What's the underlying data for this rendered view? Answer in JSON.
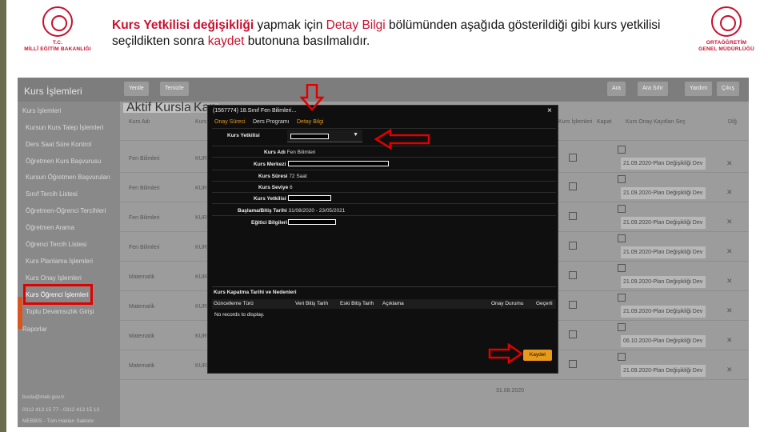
{
  "logo_left": {
    "line1": "T.C.",
    "line2": "MİLLÎ EĞİTİM BAKANLIĞI"
  },
  "logo_right": {
    "line1": "ORTAÖĞRETİM",
    "line2": "GENEL MÜDÜRLÜĞÜ"
  },
  "instruction": {
    "part1": "Kurs Yetkilisi değişikliği",
    "part2": " yapmak için ",
    "part3": "Detay Bilgi",
    "part4": " bölümünden aşağıda gösterildiği gibi kurs yetkilisi seçildikten sonra ",
    "part5": "kaydet",
    "part6": " butonuna basılmalıdır."
  },
  "app": {
    "title": "Kurs İşlemleri",
    "toolbar": [
      "Yenile",
      "Temizle"
    ],
    "toolbar_right": [
      "Ara",
      "Ara Sıfır",
      "Yardım",
      "Çıkış"
    ]
  },
  "sidebar": {
    "items": [
      "Kurs İşlemleri",
      "Kursun Kurs Talep İşlemleri",
      "Ders Saat Süre Kontrol",
      "Öğretmen Kurs Başvurusu",
      "Kursun Öğretmen Başvuruları",
      "Sınıf Tercih Listesi",
      "Öğretmen-Öğrenci Tercihleri",
      "Öğretmen Arama",
      "Öğrenci Tercih Listesi",
      "Kurs Planlama İşlemleri",
      "Kurs Onay İşlemleri",
      "Kurs Öğrenci İşlemleri",
      "Toplu Devamsızlık Girişi",
      "Raporlar"
    ],
    "footer": [
      "bsola@meb.gov.tr",
      "0312 413 15 77 - 0312 413 15 13",
      "MEBBİS - Tüm Hakları Saklıdır."
    ]
  },
  "tabs": [
    "Aktif Kurslar",
    "Kap"
  ],
  "columns": [
    "Kurs Adı",
    "Kurs",
    "Kurs İşlemleri",
    "Kapat",
    "Kurs Onay Kayıtları Seç",
    "Dİğ"
  ],
  "rows": [
    {
      "course": "Fen Bilimleri",
      "code": "KUR",
      "plan": "21.09.2020-Plan Değişikliği Dev"
    },
    {
      "course": "Fen Bilimleri",
      "code": "KUR",
      "plan": "21.09.2020-Plan Değişikliği Dev"
    },
    {
      "course": "Fen Bilimleri",
      "code": "KUR",
      "plan": "21.09.2020-Plan Değişikliği Dev"
    },
    {
      "course": "Fen Bilimleri",
      "code": "KUR",
      "plan": "21.09.2020-Plan Değişikliği Dev"
    },
    {
      "course": "Matematik",
      "code": "KUR",
      "plan": "21.09.2020-Plan Değişikliği Dev"
    },
    {
      "course": "Matematik",
      "code": "KUR",
      "plan": "21.09.2020-Plan Değişikliği Dev"
    },
    {
      "course": "Matematik",
      "code": "KUR",
      "plan": "06.10.2020-Plan Değişikliği Dev"
    },
    {
      "course": "Matematik",
      "code": "KUR",
      "plan": "21.09.2020-Plan Değişikliği Dev"
    }
  ],
  "last_row_date": "31.08.2020",
  "modal": {
    "title": "(1567774) 18.Sınıf Fen Bilimleri...",
    "close": "×",
    "tabs": [
      "Onay Süreci",
      "Ders Programı",
      "Detay Bilgi"
    ],
    "select_label": "Kurs Yetkilisi",
    "fields": [
      {
        "label": "Kurs Adı",
        "value": "Fen Bilimleri"
      },
      {
        "label": "Kurs Merkezi",
        "value": ""
      },
      {
        "label": "Kurs Süresi",
        "value": "72 Saat"
      },
      {
        "label": "Kurs Seviye",
        "value": "6"
      },
      {
        "label": "Kurs Yetkilisi",
        "value": ""
      },
      {
        "label": "Başlama/Bitiş Tarihi",
        "value": "31/08/2020 - 23/05/2021"
      },
      {
        "label": "Eğitici Bilgileri",
        "value": ""
      }
    ],
    "subpanel_title": "Kurs Kapatma Tarihi ve Nedenleri",
    "subpanel_cols": [
      "Güncelleme Türü",
      "Veri Bitiş Tarih",
      "Eski Bitiş Tarih",
      "Açıklama",
      "Onay Durumu",
      "Geçerli"
    ],
    "no_records": "No records to display.",
    "save_label": "Kaydet"
  },
  "colors": {
    "accent": "#c8102e",
    "highlight": "#e00000",
    "save": "#e89a1c"
  }
}
